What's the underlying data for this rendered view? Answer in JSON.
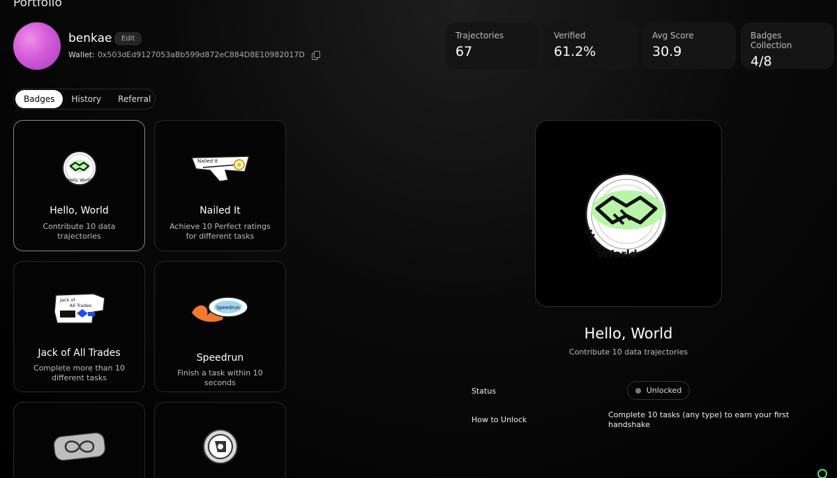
{
  "page_title": "Portfolio",
  "profile": {
    "username": "benkae",
    "edit_label": "Edit",
    "wallet_label": "Wallet:",
    "wallet_address": "0x503dEd9127053aBb599d872eC884D8E10982017D"
  },
  "stats": [
    {
      "label": "Trajectories",
      "value": "67"
    },
    {
      "label": "Verified",
      "value": "61.2%"
    },
    {
      "label": "Avg Score",
      "value": "30.9"
    },
    {
      "label": "Badges Collection",
      "value": "4/8"
    }
  ],
  "tabs": [
    {
      "label": "Badges",
      "active": true
    },
    {
      "label": "History",
      "active": false
    },
    {
      "label": "Referral",
      "active": false
    }
  ],
  "badges": [
    {
      "title": "Hello, World",
      "desc": "Contribute 10 data trajectories",
      "icon": "handshake-badge-icon"
    },
    {
      "title": "Nailed It",
      "desc": "Achieve 10 Perfect ratings for different tasks",
      "icon": "target-arrow-badge-icon"
    },
    {
      "title": "Jack of All Trades",
      "desc": "Complete more than 10 different tasks",
      "icon": "gear-puzzle-badge-icon"
    },
    {
      "title": "Speedrun",
      "desc": "Finish a task within 10 seconds",
      "icon": "flame-speed-badge-icon"
    },
    {
      "title": "",
      "desc": "",
      "icon": "infinity-badge-icon"
    },
    {
      "title": "",
      "desc": "",
      "icon": "wheel-badge-icon"
    }
  ],
  "detail": {
    "title": "Hello, World",
    "desc": "Contribute 10 data trajectories",
    "status_label": "Status",
    "status_value": "Unlocked",
    "how_label": "How to Unlock",
    "how_value": "Complete 10 tasks (any type) to earn your first handshake"
  }
}
